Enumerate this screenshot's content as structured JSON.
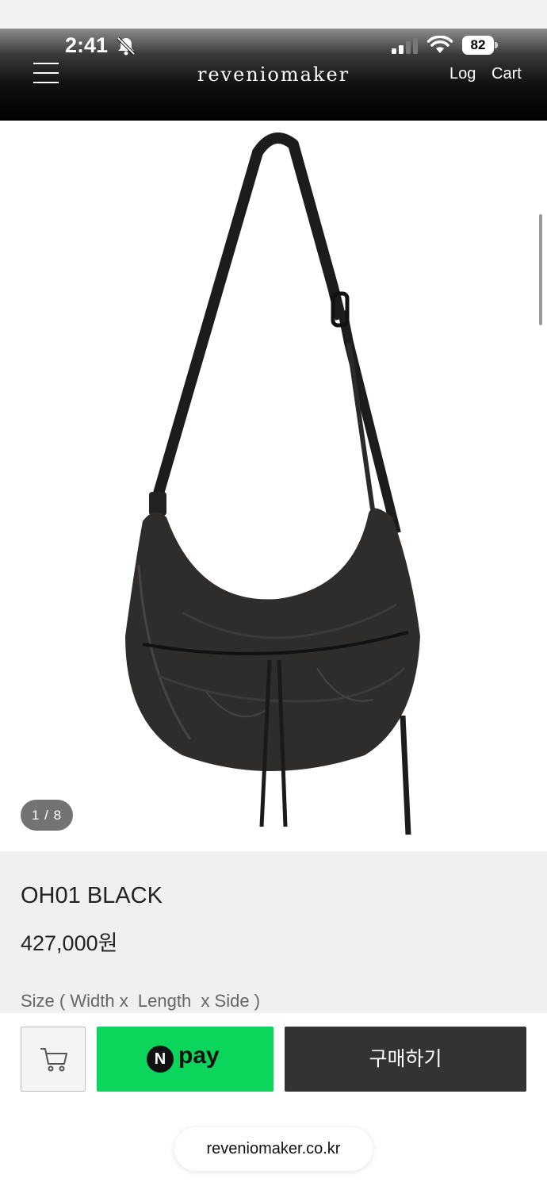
{
  "status_bar": {
    "time": "2:41",
    "battery": "82",
    "icons": [
      "bell-off-icon",
      "signal-icon",
      "wifi-icon",
      "battery-icon"
    ]
  },
  "header": {
    "brand": "reveniomaker",
    "log_label": "Log",
    "cart_label": "Cart",
    "menu_icon": "hamburger-menu-icon"
  },
  "gallery": {
    "counter": "1 / 8",
    "image_subject": "black leather crossbody bag"
  },
  "product": {
    "name": "OH01 BLACK",
    "price": "427,000원",
    "size_label": "Size ( Width x  Length  x Side )"
  },
  "actions": {
    "cart_icon": "cart-icon",
    "npay_n": "N",
    "npay_label": "pay",
    "purchase_label": "구매하기"
  },
  "browser": {
    "url": "reveniomaker.co.kr"
  },
  "colors": {
    "npay_green": "#0bd55a",
    "purchase_bg": "#333333",
    "header_bg": "#000000"
  }
}
